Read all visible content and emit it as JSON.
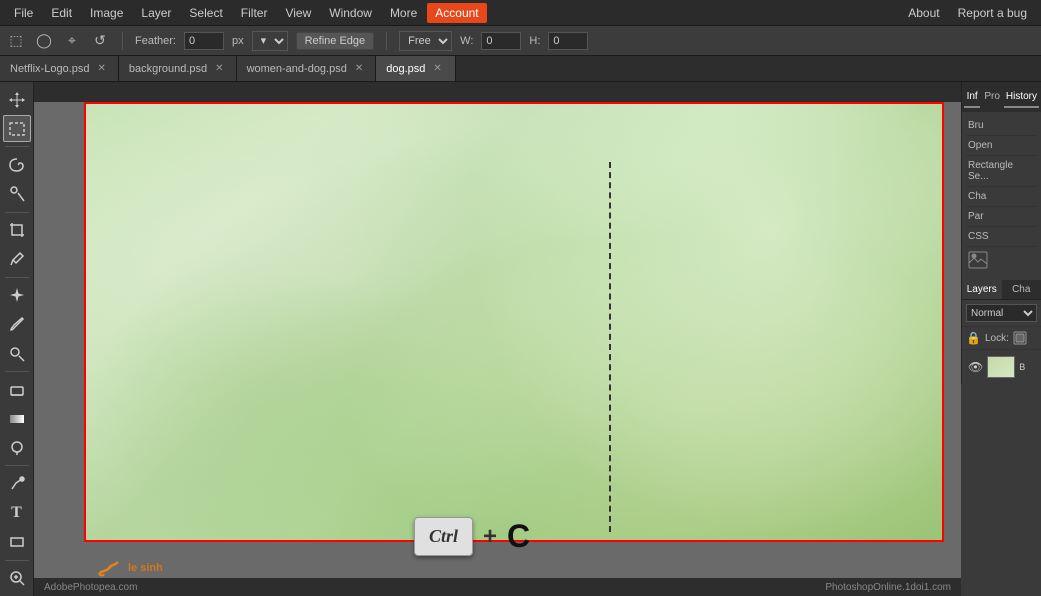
{
  "menubar": {
    "items": [
      "File",
      "Edit",
      "Image",
      "Layer",
      "Select",
      "Filter",
      "View",
      "Window",
      "More",
      "Account"
    ],
    "right_items": [
      "About",
      "Report a bug"
    ],
    "active": "Account"
  },
  "toolbar": {
    "feather_label": "Feather:",
    "feather_value": "0",
    "feather_unit": "px",
    "refine_edge_btn": "Refine Edge",
    "style_label": "Free",
    "w_label": "W:",
    "w_value": "0",
    "h_label": "H:",
    "h_value": "0"
  },
  "tabs": [
    {
      "label": "Netflix-Logo.psd",
      "modified": true
    },
    {
      "label": "background.psd",
      "modified": true
    },
    {
      "label": "women-and-dog.psd",
      "modified": true
    },
    {
      "label": "dog.psd",
      "modified": false
    }
  ],
  "active_tab": 3,
  "right_panel": {
    "tabs": [
      "Inf",
      "Pro"
    ],
    "items": [
      "Open",
      "Rectangle Se..."
    ]
  },
  "history_panel": {
    "tab_label": "History",
    "items": []
  },
  "panel_icons": [
    "Bru",
    "Cha",
    "Par",
    "CSS"
  ],
  "layers_panel": {
    "tabs": [
      "Layers",
      "Cha"
    ],
    "blend_mode": "Normal",
    "lock_label": "Lock:",
    "layer_item": "B"
  },
  "canvas": {
    "header": ""
  },
  "ctrl_c": {
    "ctrl_label": "Ctrl",
    "plus_label": "+",
    "c_label": "C"
  },
  "watermark": {
    "logo": "le sinh"
  },
  "bottom_bar": {
    "left": "AdobePhotopea.com",
    "right": "PhotoshopOnline.1doi1.com"
  },
  "toolbox": {
    "tools": [
      {
        "name": "move",
        "icon": "✥"
      },
      {
        "name": "marquee",
        "icon": "⬚"
      },
      {
        "name": "lasso",
        "icon": "⌖"
      },
      {
        "name": "wand",
        "icon": "✦"
      },
      {
        "name": "crop",
        "icon": "⊡"
      },
      {
        "name": "eyedropper",
        "icon": "⌇"
      },
      {
        "name": "heal",
        "icon": "✚"
      },
      {
        "name": "brush",
        "icon": "✏"
      },
      {
        "name": "stamp",
        "icon": "⊕"
      },
      {
        "name": "eraser",
        "icon": "◻"
      },
      {
        "name": "gradient",
        "icon": "▦"
      },
      {
        "name": "dodge",
        "icon": "◑"
      },
      {
        "name": "pen",
        "icon": "✒"
      },
      {
        "name": "text",
        "icon": "T"
      },
      {
        "name": "shape",
        "icon": "▭"
      },
      {
        "name": "zoom",
        "icon": "🔍"
      }
    ]
  }
}
